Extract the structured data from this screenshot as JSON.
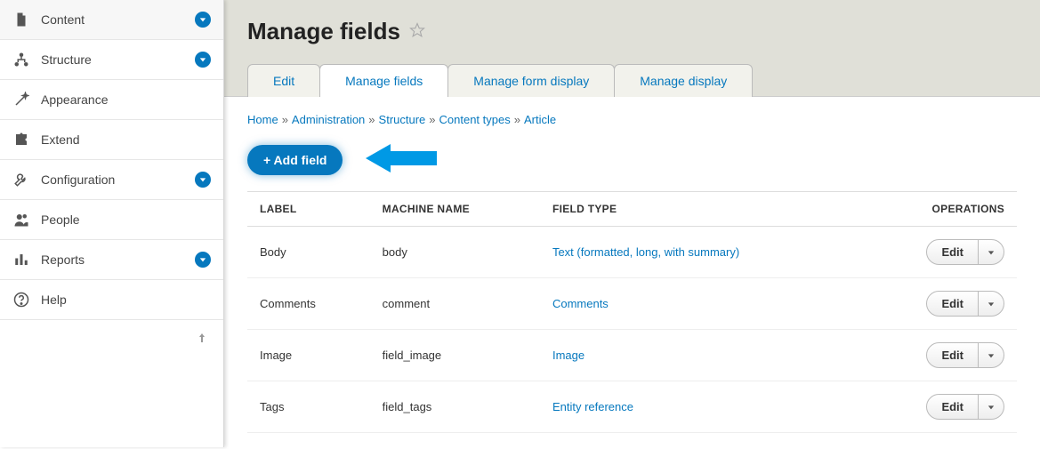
{
  "sidebar": {
    "items": [
      {
        "label": "Content",
        "icon": "file",
        "expandable": true
      },
      {
        "label": "Structure",
        "icon": "hierarchy",
        "expandable": true
      },
      {
        "label": "Appearance",
        "icon": "wand",
        "expandable": false
      },
      {
        "label": "Extend",
        "icon": "puzzle",
        "expandable": false
      },
      {
        "label": "Configuration",
        "icon": "wrench",
        "expandable": true
      },
      {
        "label": "People",
        "icon": "people",
        "expandable": false
      },
      {
        "label": "Reports",
        "icon": "bar-chart",
        "expandable": true
      },
      {
        "label": "Help",
        "icon": "help",
        "expandable": false
      }
    ]
  },
  "page": {
    "title": "Manage fields"
  },
  "tabs": [
    {
      "label": "Edit"
    },
    {
      "label": "Manage fields"
    },
    {
      "label": "Manage form display"
    },
    {
      "label": "Manage display"
    }
  ],
  "active_tab_index": 1,
  "breadcrumb": [
    "Home",
    "Administration",
    "Structure",
    "Content types",
    "Article"
  ],
  "add_field_label": "+ Add field",
  "table": {
    "headers": [
      "LABEL",
      "MACHINE NAME",
      "FIELD TYPE",
      "OPERATIONS"
    ],
    "rows": [
      {
        "label": "Body",
        "machine": "body",
        "type": "Text (formatted, long, with summary)"
      },
      {
        "label": "Comments",
        "machine": "comment",
        "type": "Comments"
      },
      {
        "label": "Image",
        "machine": "field_image",
        "type": "Image"
      },
      {
        "label": "Tags",
        "machine": "field_tags",
        "type": "Entity reference"
      }
    ],
    "edit_label": "Edit"
  }
}
